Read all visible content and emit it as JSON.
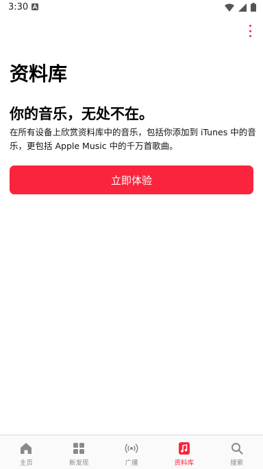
{
  "status_bar": {
    "time": "3:30"
  },
  "library": {
    "title": "资料库",
    "headline": "你的音乐，无处不在。",
    "description": "在所有设备上欣赏资料库中的音乐，包括你添加到 iTunes 中的音乐，更包括 Apple Music 中的千万首歌曲。",
    "cta_label": "立即体验"
  },
  "tabs": [
    {
      "label": "主页",
      "icon": "home-icon"
    },
    {
      "label": "新发现",
      "icon": "grid-icon"
    },
    {
      "label": "广播",
      "icon": "radio-icon"
    },
    {
      "label": "资料库",
      "icon": "library-icon",
      "active": true
    },
    {
      "label": "搜索",
      "icon": "search-icon"
    }
  ],
  "colors": {
    "accent": "#fa243c",
    "menu_dots": "#e02b42",
    "tab_inactive": "#8a8a8e"
  }
}
